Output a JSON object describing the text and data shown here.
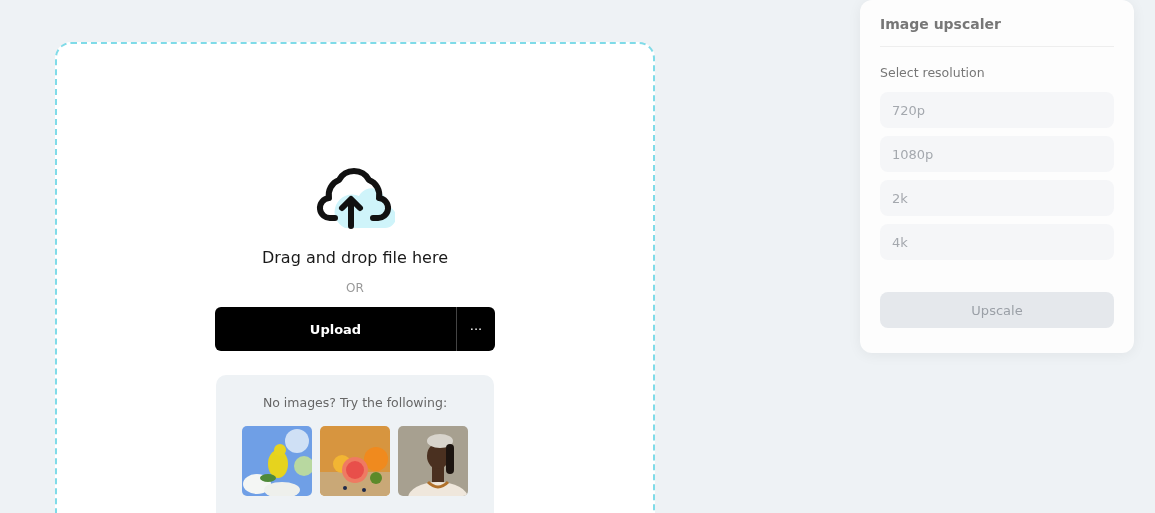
{
  "dropzone": {
    "title": "Drag and drop file here",
    "separator": "OR",
    "upload_button": "Upload",
    "more_button": "···",
    "samples": {
      "prompt": "No images? Try the following:"
    }
  },
  "panel": {
    "title": "Image upscaler",
    "section_label": "Select resolution",
    "options": [
      {
        "label": "720p",
        "selected": false
      },
      {
        "label": "1080p",
        "selected": false
      },
      {
        "label": "2k",
        "selected": false
      },
      {
        "label": "4k",
        "selected": false
      }
    ],
    "action": {
      "label": "Upscale",
      "disabled": true
    }
  }
}
